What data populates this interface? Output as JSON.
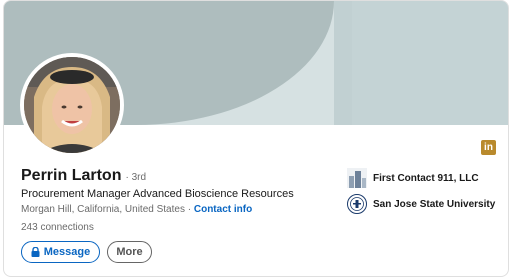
{
  "profile": {
    "name": "Perrin Larton",
    "degree": "· 3rd",
    "headline": "Procurement Manager Advanced Bioscience Resources",
    "location": "Morgan Hill, California, United States",
    "separator": " · ",
    "contact_info_label": "Contact info",
    "connections": "243 connections"
  },
  "actions": {
    "message_label": "Message",
    "more_label": "More"
  },
  "experience": [
    {
      "label": "First Contact 911, LLC",
      "icon": "company-logo"
    },
    {
      "label": "San Jose State University",
      "icon": "university-seal"
    }
  ],
  "icons": {
    "linkedin_badge": "in",
    "lock": "lock-icon"
  },
  "colors": {
    "accent": "#0a66c2",
    "banner": "#aebdbe",
    "linkedin_badge": "#b98a2c"
  }
}
